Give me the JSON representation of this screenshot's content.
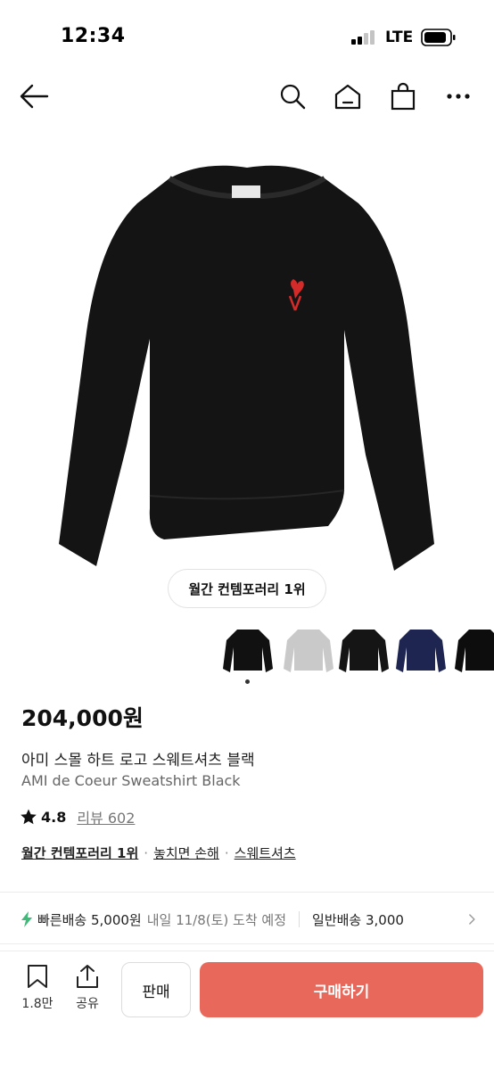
{
  "status_bar": {
    "time": "12:34",
    "network": "LTE"
  },
  "nav": {
    "back_icon": "arrow-left-icon",
    "search_icon": "search-icon",
    "home_icon": "home-icon",
    "bag_icon": "shopping-bag-icon",
    "more_icon": "more-horizontal-icon"
  },
  "product": {
    "rank_badge": "월간 컨템포러리 1위",
    "thumbnail_colors": [
      "#111111",
      "#c9c9c9",
      "#151515",
      "#1d2550",
      "#0d0d0d"
    ],
    "price": "204,000원",
    "name_ko": "아미 스몰 하트 로고 스웨트셔츠 블랙",
    "name_en": "AMI de Coeur Sweatshirt Black",
    "rating": "4.8",
    "review_label": "리뷰 602",
    "tags": [
      "월간 컨템포러리 1위",
      "놓치면 손해",
      "스웨트셔츠"
    ],
    "tag_separator": "·"
  },
  "shipping": {
    "fast_label": "빠른배송 5,000원",
    "fast_date": "내일 11/8(토) 도착 예정",
    "normal_label": "일반배송 3,000",
    "accent_color": "#41b979"
  },
  "action_bar": {
    "save_count": "1.8만",
    "share_label": "공유",
    "sell_label": "판매",
    "buy_label": "구매하기",
    "buy_color": "#e8685b"
  }
}
